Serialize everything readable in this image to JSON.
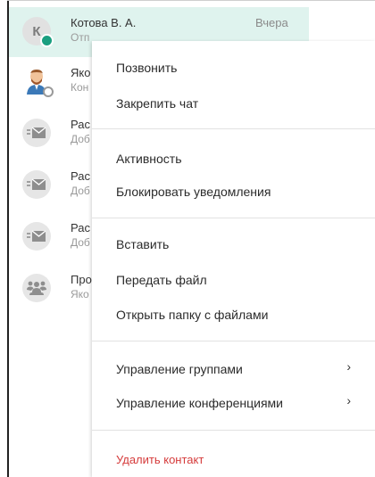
{
  "chats": [
    {
      "name": "Котова В. А.",
      "sub": "Отп",
      "time": "Вчера",
      "avatar_letter": "К",
      "avatar_type": "letter",
      "status": "online",
      "selected": true
    },
    {
      "name": "Яко",
      "sub": "Кон",
      "avatar_type": "person",
      "status": "offline"
    },
    {
      "name": "Рас",
      "sub": "Доб",
      "avatar_type": "mail"
    },
    {
      "name": "Рас",
      "sub": "Доб",
      "avatar_type": "mail"
    },
    {
      "name": "Рас",
      "sub": "Доб",
      "avatar_type": "mail"
    },
    {
      "name": "Про",
      "sub": "Яко",
      "avatar_type": "group"
    }
  ],
  "menu": {
    "call": "Позвонить",
    "pin_chat": "Закрепить чат",
    "activity": "Активность",
    "block_notifications": "Блокировать уведомления",
    "paste": "Вставить",
    "send_file": "Передать файл",
    "open_files_folder": "Открыть папку с файлами",
    "manage_groups": "Управление группами",
    "manage_conferences": "Управление конференциями",
    "delete_contact": "Удалить контакт",
    "submenu_chevron": "›"
  },
  "colors": {
    "selected_bg": "#dff3ee",
    "online": "#1a9f80",
    "danger": "#d53b3b"
  }
}
